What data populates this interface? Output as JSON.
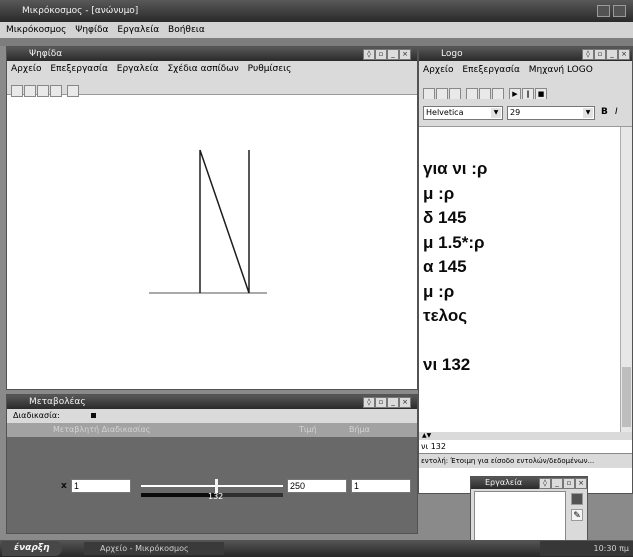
{
  "app": {
    "title": "Μικρόκοσμος - [ανώνυμο]",
    "menu": [
      "Μικρόκοσμος",
      "Ψηφίδα",
      "Εργαλεία",
      "Βοήθεια"
    ]
  },
  "main_window": {
    "title": "Ψηφίδα",
    "menu": [
      "Αρχείο",
      "Επεξεργασία",
      "Εργαλεία",
      "Σχέδια ασπίδων",
      "Ρυθμίσεις"
    ]
  },
  "logo_window": {
    "title": "Logo",
    "menu": [
      "Αρχείο",
      "Επεξεργασία",
      "Μηχανή LOGO"
    ],
    "font": "Helvetica",
    "size": "29",
    "bold": "B",
    "italic": "I",
    "code_lines": [
      "για νι :ρ",
      "μ :ρ",
      "δ 145",
      "μ 1.5*:ρ",
      "α 145",
      "μ :ρ",
      "τελος"
    ],
    "command": "νι 132",
    "status_cmd": "νι 132",
    "status": "εντολή: Έτοιμη για είσοδο εντολών/δεδομένων..."
  },
  "slider_window": {
    "title": "Μεταβολέας",
    "label": "Διαδικασία:",
    "header_left": "Μεταβλητή Διαδικασίας",
    "header_mid": "Τιμή",
    "header_right": "Βήμα",
    "var": "x",
    "min": "1",
    "value": "132",
    "max": "250",
    "step": "1",
    "fraction": 0.53
  },
  "small_window": {
    "title": "Εργαλεία"
  },
  "taskbar": {
    "start": "έναρξη",
    "task": "Αρχείο - Μικρόκοσμος",
    "clock": "10:30 πμ"
  }
}
